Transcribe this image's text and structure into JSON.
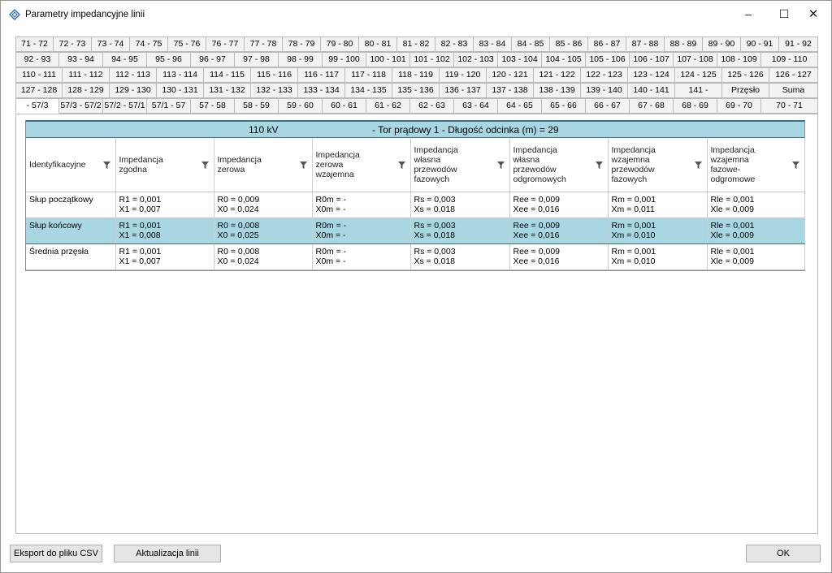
{
  "window": {
    "title": "Parametry impedancyjne linii",
    "min_glyph": "–",
    "max_glyph": "☐",
    "close_glyph": "✕"
  },
  "tab_rows": [
    [
      "71 - 72",
      "72 - 73",
      "73 - 74",
      "74 - 75",
      "75 - 76",
      "76 - 77",
      "77 - 78",
      "78 - 79",
      "79 - 80",
      "80 - 81",
      "81 - 82",
      "82 - 83",
      "83 - 84",
      "84 - 85",
      "85 - 86",
      "86 - 87",
      "87 - 88",
      "88 - 89",
      "89 - 90",
      "90 - 91",
      "91 - 92"
    ],
    [
      "92 - 93",
      "93 - 94",
      "94 - 95",
      "95 - 96",
      "96 - 97",
      "97 - 98",
      "98 - 99",
      "99 - 100",
      "100 - 101",
      "101 - 102",
      "102 - 103",
      "103 - 104",
      "104 - 105",
      "105 - 106",
      "106 - 107",
      "107 - 108",
      "108 - 109",
      "109 - 110"
    ],
    [
      "110 - 111",
      "111 - 112",
      "112 - 113",
      "113 - 114",
      "114 - 115",
      "115 - 116",
      "116 - 117",
      "117 - 118",
      "118 - 119",
      "119 - 120",
      "120 - 121",
      "121 - 122",
      "122 - 123",
      "123 - 124",
      "124 - 125",
      "125 - 126",
      "126 - 127"
    ],
    [
      "127 - 128",
      "128 - 129",
      "129 - 130",
      "130 - 131",
      "131 - 132",
      "132 - 133",
      "133 - 134",
      "134 - 135",
      "135 - 136",
      "136 - 137",
      "137 - 138",
      "138 - 139",
      "139 - 140",
      "140 - 141",
      "141 -",
      "Przęsło",
      "Suma"
    ],
    [
      "- 57/3",
      "57/3 - 57/2",
      "57/2 - 57/1",
      "57/1 - 57",
      "57 - 58",
      "58 - 59",
      "59 - 60",
      "60 - 61",
      "61 - 62",
      "62 - 63",
      "63 - 64",
      "64 - 65",
      "65 - 66",
      "66 - 67",
      "67 - 68",
      "68 - 69",
      "69 - 70",
      "70 - 71"
    ]
  ],
  "selected_tab": "- 57/3",
  "grid": {
    "voltage": "110 kV",
    "description": "- Tor prądowy 1 - Długość odcinka (m) = 29",
    "columns": [
      "Identyfikacyjne",
      "Impedancja\nzgodna",
      "Impedancja\nzerowa",
      "Impedancja\nzerowa\nwzajemna",
      "Impedancja\nwłasna\nprzewodów\nfazowych",
      "Impedancja\nwłasna\nprzewodów\nodgromowych",
      "Impedancja\nwzajemna\nprzewodów\nfazowych",
      "Impedancja\nwzajemna\nfazowe-\nodgromowe"
    ],
    "rows": [
      [
        "Słup początkowy",
        "R1 = 0,001\nX1 = 0,007",
        "R0 = 0,009\nX0 = 0,024",
        "R0m = -\nX0m = -",
        "Rs = 0,003\nXs = 0,018",
        "Ree = 0,009\nXee = 0,016",
        "Rm = 0,001\nXm = 0,011",
        "Rle = 0,001\nXle = 0,009"
      ],
      [
        "Słup końcowy",
        "R1 = 0,001\nX1 = 0,008",
        "R0 = 0,008\nX0 = 0,025",
        "R0m = -\nX0m = -",
        "Rs = 0,003\nXs = 0,018",
        "Ree = 0,009\nXee = 0,016",
        "Rm = 0,001\nXm = 0,010",
        "Rle = 0,001\nXle = 0,009"
      ],
      [
        "Średnia przęsła",
        "R1 = 0,001\nX1 = 0,007",
        "R0 = 0,008\nX0 = 0,024",
        "R0m = -\nX0m = -",
        "Rs = 0,003\nXs = 0,018",
        "Ree = 0,009\nXee = 0,016",
        "Rm = 0,001\nXm = 0,010",
        "Rle = 0,001\nXle = 0,009"
      ]
    ],
    "selected_row": 1
  },
  "buttons": {
    "export_csv": "Eksport do pliku CSV",
    "update_line": "Aktualizacja linii",
    "ok": "OK"
  },
  "colors": {
    "header_bg": "#a8d7e3",
    "selection_bg": "#a8d7e3"
  }
}
